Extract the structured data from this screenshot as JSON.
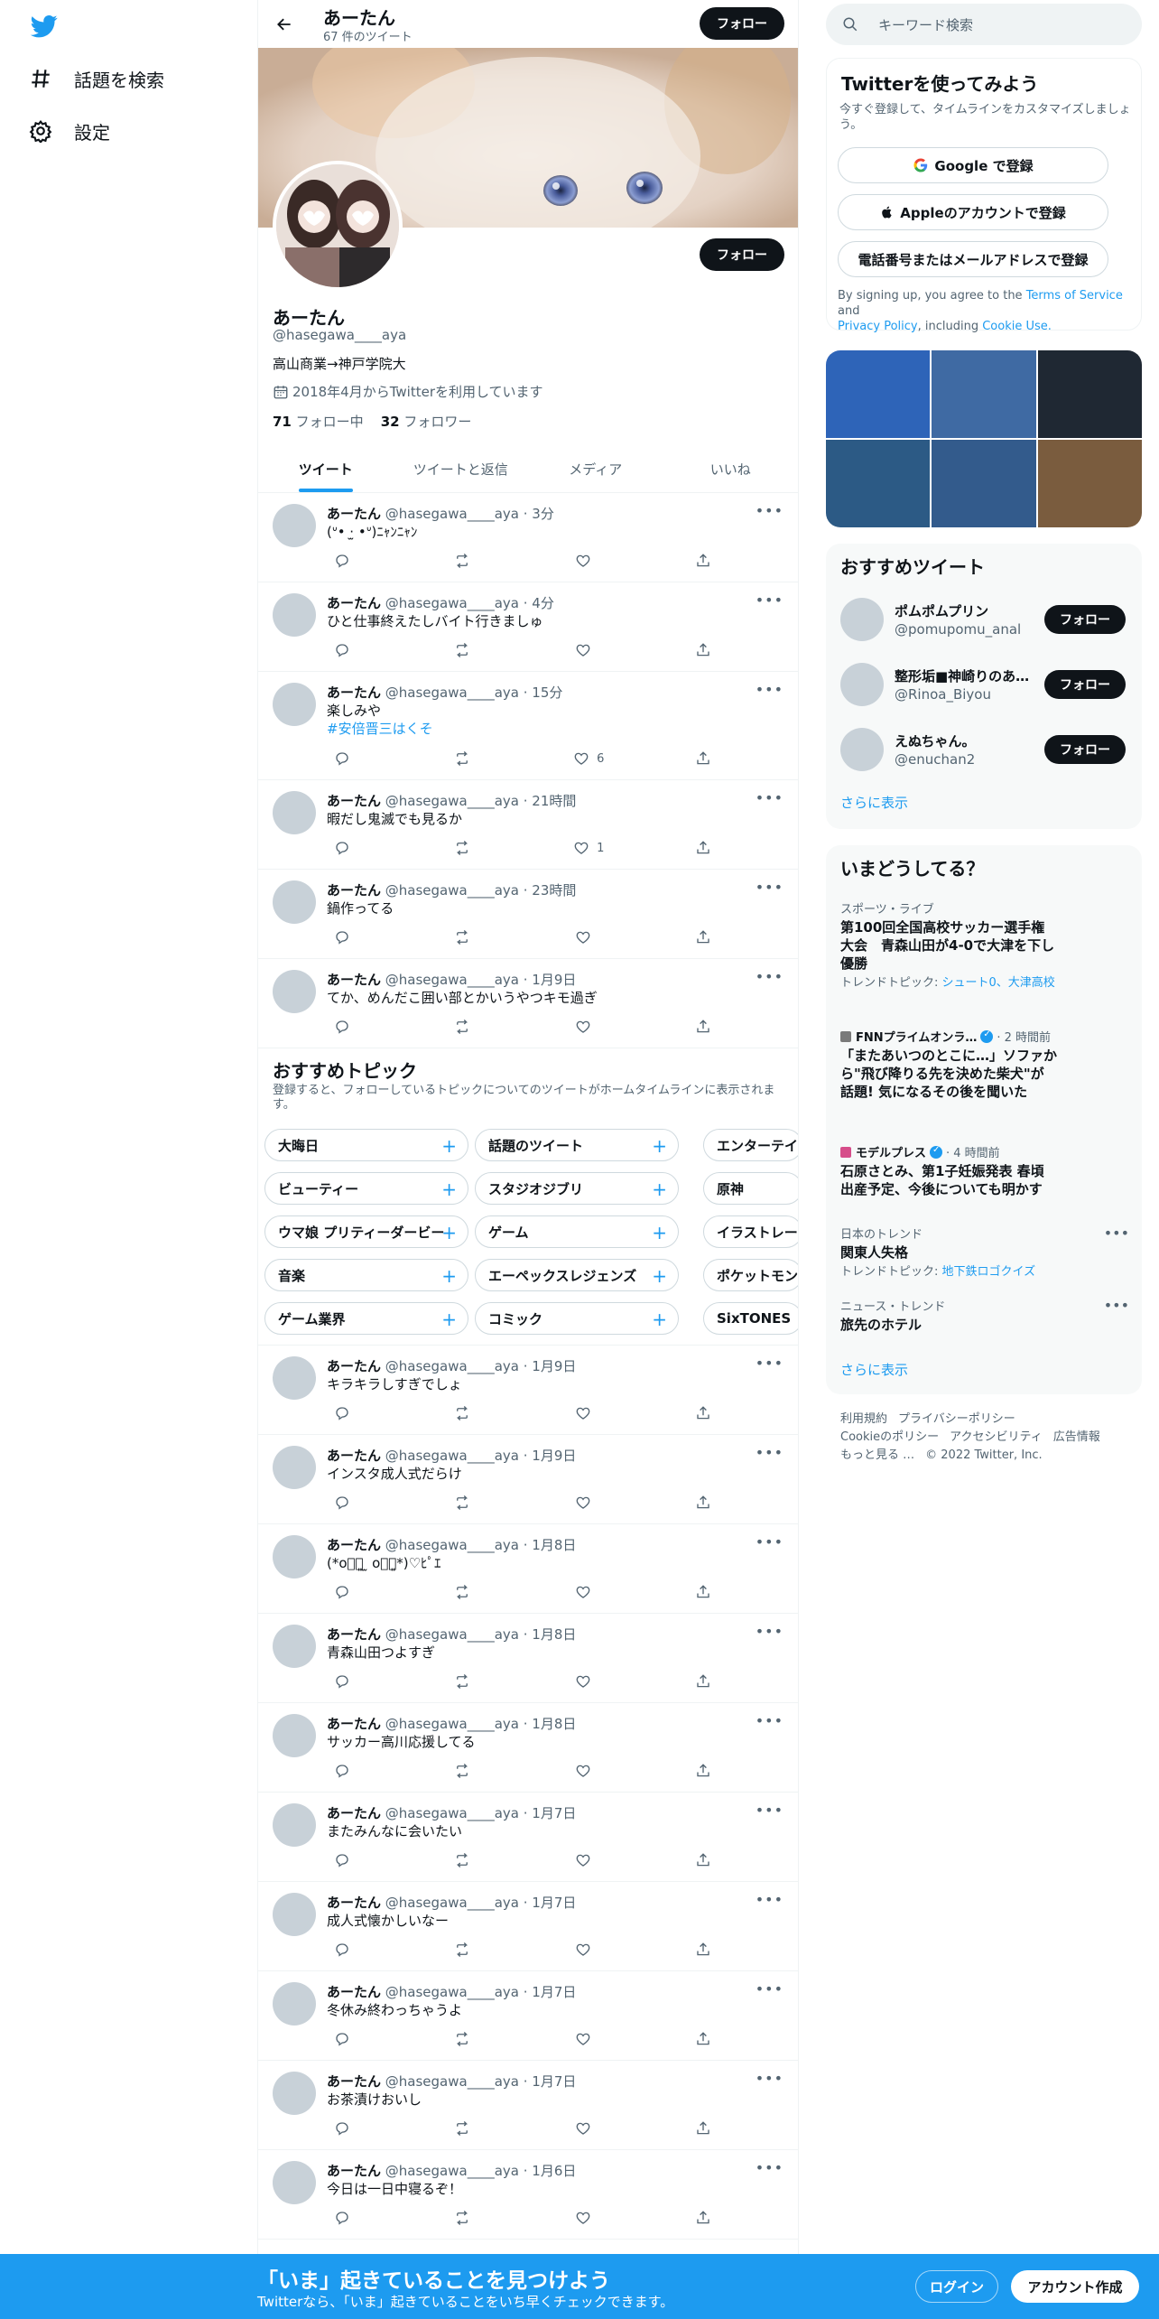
{
  "nav": {
    "explore_label": "話題を検索",
    "settings_label": "設定"
  },
  "header": {
    "name": "あーたん",
    "tweet_count": "67 件のツイート",
    "follow_label": "フォロー"
  },
  "profile": {
    "name": "あーたん",
    "handle": "@hasegawa____aya",
    "bio": "高山商業→神戸学院大",
    "joined": "2018年4月からTwitterを利用しています",
    "following_count": "71",
    "following_label": "フォロー中",
    "followers_count": "32",
    "followers_label": "フォロワー",
    "follow_label": "フォロー"
  },
  "tabs": [
    "ツイート",
    "ツイートと返信",
    "メディア",
    "いいね"
  ],
  "tweets_top": [
    {
      "name": "あーたん",
      "handle": "@hasegawa____aya · 3分",
      "text": "  (ᐡ• ·̫ •ᐡ)ﾆｬﾝﾆｬﾝ",
      "tag": "",
      "likes": ""
    },
    {
      "name": "あーたん",
      "handle": "@hasegawa____aya · 4分",
      "text": "ひと仕事終えたしバイト行きましゅ",
      "tag": "",
      "likes": ""
    },
    {
      "name": "あーたん",
      "handle": "@hasegawa____aya · 15分",
      "text": "楽しみや",
      "tag": "#安倍晋三はくそ",
      "likes": "6"
    },
    {
      "name": "あーたん",
      "handle": "@hasegawa____aya · 21時間",
      "text": "暇だし鬼滅でも見るか",
      "tag": "",
      "likes": "1"
    },
    {
      "name": "あーたん",
      "handle": "@hasegawa____aya · 23時間",
      "text": "鍋作ってる",
      "tag": "",
      "likes": ""
    },
    {
      "name": "あーたん",
      "handle": "@hasegawa____aya · 1月9日",
      "text": "てか、めんだこ囲い部とかいうやつキモ過ぎ",
      "tag": "",
      "likes": ""
    }
  ],
  "topics": {
    "title": "おすすめトピック",
    "subtitle": "登録すると、フォローしているトピックについてのツイートがホームタイムラインに表示されます。",
    "rows": [
      [
        "大晦日",
        "話題のツイート",
        "エンターテイ"
      ],
      [
        "ビューティー",
        "スタジオジブリ",
        "原神"
      ],
      [
        "ウマ娘 プリティーダービー",
        "ゲーム",
        "イラストレー"
      ],
      [
        "音楽",
        "エーペックスレジェンズ",
        "ポケットモン"
      ],
      [
        "ゲーム業界",
        "コミック",
        "SixTONES"
      ]
    ]
  },
  "tweets_bottom": [
    {
      "name": "あーたん",
      "handle": "@hasegawa____aya · 1月9日",
      "text": "キラキラしすぎでしょ"
    },
    {
      "name": "あーたん",
      "handle": "@hasegawa____aya · 1月9日",
      "text": "インスタ成人式だらけ"
    },
    {
      "name": "あーたん",
      "handle": "@hasegawa____aya · 1月8日",
      "text": "(*o⃝⃘͈ ̫ o⃝⃘͈*)♡ﾋﾟｴ"
    },
    {
      "name": "あーたん",
      "handle": "@hasegawa____aya · 1月8日",
      "text": "青森山田つよすぎ"
    },
    {
      "name": "あーたん",
      "handle": "@hasegawa____aya · 1月8日",
      "text": "サッカー高川応援してる"
    },
    {
      "name": "あーたん",
      "handle": "@hasegawa____aya · 1月7日",
      "text": "またみんなに会いたい"
    },
    {
      "name": "あーたん",
      "handle": "@hasegawa____aya · 1月7日",
      "text": "成人式懐かしいなー"
    },
    {
      "name": "あーたん",
      "handle": "@hasegawa____aya · 1月7日",
      "text": "冬休み終わっちゃうよ"
    },
    {
      "name": "あーたん",
      "handle": "@hasegawa____aya · 1月7日",
      "text": "お茶漬けおいし"
    },
    {
      "name": "あーたん",
      "handle": "@hasegawa____aya · 1月6日",
      "text": "今日は一日中寝るぞ！"
    }
  ],
  "search": {
    "placeholder": "キーワード検索"
  },
  "signup": {
    "title": "Twitterを使ってみよう",
    "subtitle": "今すぐ登録して、タイムラインをカスタマイズしましょう。",
    "google_label": "Google で登録",
    "apple_label": "Appleのアカウントで登録",
    "phone_label": "電話番号またはメールアドレスで登録",
    "legal_prefix": "By signing up, you agree to the",
    "terms": "Terms of Service",
    "and": "and",
    "privacy": "Privacy Policy",
    "including": ", including",
    "cookie": "Cookie Use."
  },
  "media_colors": [
    "#2e64b8",
    "#3f6aa3",
    "#1f2833",
    "#2c5a85",
    "#335b8c",
    "#7a5c3e"
  ],
  "suggest": {
    "title": "おすすめツイート",
    "users": [
      {
        "name": "ポムポムプリン",
        "handle": "@pomupomu_anal"
      },
      {
        "name": "整形垢■神崎りのあ…",
        "handle": "@Rinoa_Biyou"
      },
      {
        "name": "えぬちゃん。",
        "handle": "@enuchan2"
      }
    ],
    "follow_label": "フォロー",
    "more": "さらに表示"
  },
  "trends": {
    "title": "いまどうしてる？",
    "items": [
      {
        "meta": "スポーツ・ライブ",
        "title": "第100回全国高校サッカー選手権大会　青森山田が4-0で大津を下し優勝",
        "sub_prefix": "トレンドトピック: ",
        "sub_link": "シュート0、大津高校"
      },
      {
        "meta": "FNNプライムオンラ…",
        "meta_time": "· 2 時間前",
        "title": "「またあいつのとこに…」ソファから\"飛び降りる先を決めた柴犬\"が話題! 気になるその後を聞いた",
        "sub_prefix": "",
        "sub_link": ""
      },
      {
        "meta": "モデルプレス",
        "meta_time": "· 4 時間前",
        "title": "石原さとみ、第1子妊娠発表 春頃出産予定、今後についても明かす",
        "sub_prefix": "",
        "sub_link": ""
      },
      {
        "meta": "日本のトレンド",
        "title": "関東人失格",
        "sub_prefix": "トレンドトピック: ",
        "sub_link": "地下鉄ロゴクイズ"
      },
      {
        "meta": "ニュース・トレンド",
        "title": "旅先のホテル",
        "sub_prefix": "",
        "sub_link": ""
      }
    ],
    "more": "さらに表示"
  },
  "footer": [
    "利用規約",
    "プライバシーポリシー",
    "Cookieのポリシー",
    "アクセシビリティ",
    "広告情報",
    "もっと見る …",
    "© 2022 Twitter, Inc."
  ],
  "bottombar": {
    "title": "「いま」起きていることを見つけよう",
    "subtitle": "Twitterなら、「いま」起きていることをいち早くチェックできます。",
    "login": "ログイン",
    "signup": "アカウント作成"
  }
}
